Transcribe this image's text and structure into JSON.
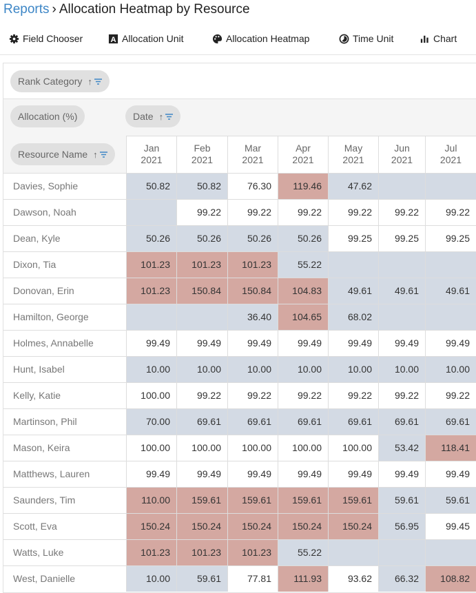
{
  "breadcrumb": {
    "parent": "Reports",
    "separator": "›",
    "current": "Allocation Heatmap by Resource"
  },
  "toolbar": [
    {
      "label": "Field Chooser",
      "icon": "gear-icon"
    },
    {
      "label": "Allocation Unit",
      "icon": "letter-a-icon"
    },
    {
      "label": "Allocation Heatmap",
      "icon": "palette-icon"
    },
    {
      "label": "Time Unit",
      "icon": "clock-icon"
    },
    {
      "label": "Chart",
      "icon": "bar-chart-icon"
    }
  ],
  "pills": {
    "rank": "Rank Category",
    "allocation": "Allocation (%)",
    "date": "Date",
    "resource": "Resource Name",
    "sort_arrow": "↑"
  },
  "colors": {
    "under": "#d3dae4",
    "normal": "#ffffff",
    "over": "#d4a8a1",
    "accent": "#3d86c6"
  },
  "columns": [
    [
      "Jan",
      "2021"
    ],
    [
      "Feb",
      "2021"
    ],
    [
      "Mar",
      "2021"
    ],
    [
      "Apr",
      "2021"
    ],
    [
      "May",
      "2021"
    ],
    [
      "Jun",
      "2021"
    ],
    [
      "Jul",
      "2021"
    ]
  ],
  "rows": [
    {
      "name": "Davies, Sophie",
      "values": [
        "50.82",
        "50.82",
        "76.30",
        "119.46",
        "47.62",
        "",
        ""
      ],
      "heat": "bbwrbbb"
    },
    {
      "name": "Dawson, Noah",
      "values": [
        "",
        "99.22",
        "99.22",
        "99.22",
        "99.22",
        "99.22",
        "99.22"
      ],
      "heat": "bwwwwww"
    },
    {
      "name": "Dean, Kyle",
      "values": [
        "50.26",
        "50.26",
        "50.26",
        "50.26",
        "99.25",
        "99.25",
        "99.25"
      ],
      "heat": "bbbbwww"
    },
    {
      "name": "Dixon, Tia",
      "values": [
        "101.23",
        "101.23",
        "101.23",
        "55.22",
        "",
        "",
        ""
      ],
      "heat": "rrrbbbb"
    },
    {
      "name": "Donovan, Erin",
      "values": [
        "101.23",
        "150.84",
        "150.84",
        "104.83",
        "49.61",
        "49.61",
        "49.61"
      ],
      "heat": "rrrrbbb"
    },
    {
      "name": "Hamilton, George",
      "values": [
        "",
        "",
        "36.40",
        "104.65",
        "68.02",
        "",
        ""
      ],
      "heat": "bbbrbbb"
    },
    {
      "name": "Holmes, Annabelle",
      "values": [
        "99.49",
        "99.49",
        "99.49",
        "99.49",
        "99.49",
        "99.49",
        "99.49"
      ],
      "heat": "wwwwwww"
    },
    {
      "name": "Hunt, Isabel",
      "values": [
        "10.00",
        "10.00",
        "10.00",
        "10.00",
        "10.00",
        "10.00",
        "10.00"
      ],
      "heat": "bbbbbbb"
    },
    {
      "name": "Kelly, Katie",
      "values": [
        "100.00",
        "99.22",
        "99.22",
        "99.22",
        "99.22",
        "99.22",
        "99.22"
      ],
      "heat": "wwwwwww"
    },
    {
      "name": "Martinson, Phil",
      "values": [
        "70.00",
        "69.61",
        "69.61",
        "69.61",
        "69.61",
        "69.61",
        "69.61"
      ],
      "heat": "bbbbbbb"
    },
    {
      "name": "Mason, Keira",
      "values": [
        "100.00",
        "100.00",
        "100.00",
        "100.00",
        "100.00",
        "53.42",
        "118.41"
      ],
      "heat": "wwwwwbr"
    },
    {
      "name": "Matthews, Lauren",
      "values": [
        "99.49",
        "99.49",
        "99.49",
        "99.49",
        "99.49",
        "99.49",
        "99.49"
      ],
      "heat": "wwwwwww"
    },
    {
      "name": "Saunders, Tim",
      "values": [
        "110.00",
        "159.61",
        "159.61",
        "159.61",
        "159.61",
        "59.61",
        "59.61"
      ],
      "heat": "rrrrrbb"
    },
    {
      "name": "Scott, Eva",
      "values": [
        "150.24",
        "150.24",
        "150.24",
        "150.24",
        "150.24",
        "56.95",
        "99.45"
      ],
      "heat": "rrrrrbw"
    },
    {
      "name": "Watts, Luke",
      "values": [
        "101.23",
        "101.23",
        "101.23",
        "55.22",
        "",
        "",
        ""
      ],
      "heat": "rrrbbbb"
    },
    {
      "name": "West, Danielle",
      "values": [
        "10.00",
        "59.61",
        "77.81",
        "111.93",
        "93.62",
        "66.32",
        "108.82"
      ],
      "heat": "bbwrwbr"
    }
  ]
}
